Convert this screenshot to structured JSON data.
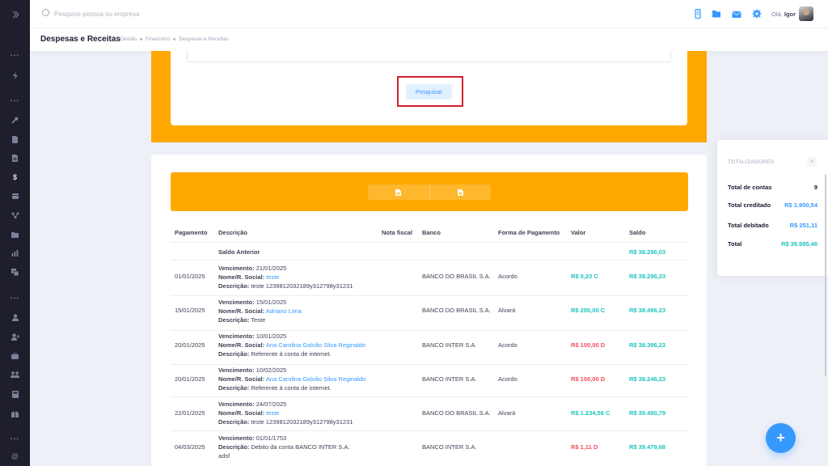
{
  "header": {
    "search_placeholder": "Pesquise pessoa ou empresa",
    "greeting_prefix": "Olá,",
    "user_name": "Igor"
  },
  "subheader": {
    "title": "Despesas e Receitas",
    "breadcrumb": [
      "Gestão",
      "Financeiro",
      "Despesas e Receitas"
    ]
  },
  "filter": {
    "search_button": "Pesquisar"
  },
  "table": {
    "headers": [
      "Pagamento",
      "Descrição",
      "Nota fiscal",
      "Banco",
      "Forma de Pagamento",
      "Valor",
      "Saldo"
    ],
    "saldo_anterior": {
      "label": "Saldo Anterior",
      "saldo": "R$ 38.296,03"
    },
    "labels": {
      "vencimento": "Vencimento:",
      "nome": "Nome/R. Social:",
      "descricao": "Descrição:"
    },
    "rows": [
      {
        "pagamento": "01/01/2025",
        "vencimento": "21/01/2025",
        "nome": "teste",
        "descricao": "teste 1239812032189y312798y31231",
        "banco": "BANCO DO BRASIL S.A.",
        "forma": "Acordo",
        "valor": "R$ 0,20 C",
        "saldo": "R$ 38.296,23"
      },
      {
        "pagamento": "15/01/2025",
        "vencimento": "15/01/2025",
        "nome": "Adriano Lima",
        "descricao": "Teste",
        "banco": "BANCO DO BRASIL S.A.",
        "forma": "Alvará",
        "valor": "R$ 200,00 C",
        "saldo": "R$ 38.496,23"
      },
      {
        "pagamento": "20/01/2025",
        "vencimento": "10/01/2025",
        "nome": "Ana Carolina Galvão Silva Reginaldo",
        "descricao": "Referente à conta de internet.",
        "banco": "BANCO INTER S.A.",
        "forma": "Acordo",
        "valor": "R$ 100,00 D",
        "saldo": "R$ 38.396,23"
      },
      {
        "pagamento": "20/01/2025",
        "vencimento": "10/02/2025",
        "nome": "Ana Carolina Galvão Silva Reginaldo",
        "descricao": "Referente à conta de internet.",
        "banco": "BANCO INTER S.A.",
        "forma": "Acordo",
        "valor": "R$ 150,00 D",
        "saldo": "R$ 38.246,23"
      },
      {
        "pagamento": "22/01/2025",
        "vencimento": "24/07/2025",
        "nome": "teste",
        "descricao": "teste 1239812032189y312798y31231",
        "banco": "BANCO DO BRASIL S.A.",
        "forma": "Alvará",
        "valor": "R$ 1.234,56 C",
        "saldo": "R$ 39.480,79"
      },
      {
        "pagamento": "04/03/2025",
        "vencimento": "01/01/1753",
        "descricao": "Debito da conta BANCO INTER S.A.",
        "extra": "adsf",
        "banco": "BANCO INTER S.A.",
        "forma": "",
        "valor": "R$ 1,11 D",
        "saldo": "R$ 39.479,68"
      }
    ]
  },
  "totals": {
    "title": "TOTALIZADORES",
    "close": "×",
    "items": [
      {
        "label": "Total de contas",
        "value": "9"
      },
      {
        "label": "Total creditado",
        "value": "R$ 1.950,54"
      },
      {
        "label": "Total debitado",
        "value": "R$ 251,11"
      },
      {
        "label": "Total",
        "value": "R$ 39.995,46"
      }
    ]
  },
  "fab": {
    "label": "+"
  },
  "colors": {
    "accent_orange": "#ffa800",
    "primary_blue": "#3699ff",
    "credit_teal": "#1bc5bd",
    "debit_red": "#f64e60",
    "sidebar_bg": "#1e1e2d",
    "highlight_red": "#d0202e"
  }
}
